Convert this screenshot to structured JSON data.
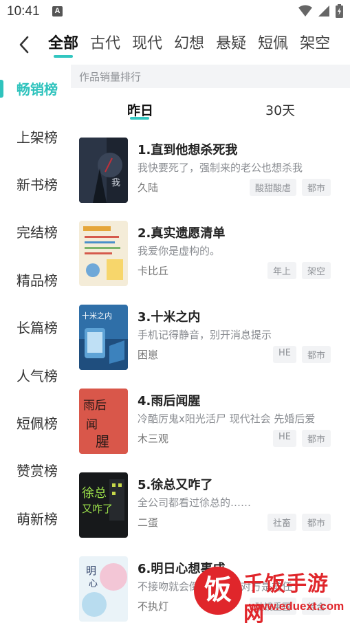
{
  "status": {
    "time": "10:41",
    "badge": "A"
  },
  "top_tabs": [
    "全部",
    "古代",
    "现代",
    "幻想",
    "悬疑",
    "短佩",
    "架空"
  ],
  "top_tabs_active": 0,
  "sidebar": [
    "畅销榜",
    "上架榜",
    "新书榜",
    "完结榜",
    "精品榜",
    "长篇榜",
    "人气榜",
    "短佩榜",
    "赞赏榜",
    "萌新榜"
  ],
  "sidebar_active": 0,
  "rank_header": "作品销量排行",
  "period_tabs": {
    "yesterday": "昨日",
    "thirty_days": "30天"
  },
  "accent_color": "#32c6c0",
  "books": [
    {
      "title": "1.直到他想杀死我",
      "desc": "我快要死了，强制来的老公也想杀我",
      "author": "久陆",
      "tags": [
        "酸甜酸虐",
        "都市"
      ]
    },
    {
      "title": "2.真实遗愿清单",
      "desc": "我爱你是虚构的。",
      "author": "卡比丘",
      "tags": [
        "年上",
        "架空"
      ]
    },
    {
      "title": "3.十米之内",
      "desc": "手机记得静音，别开消息提示",
      "author": "困崽",
      "tags": [
        "HE",
        "都市"
      ]
    },
    {
      "title": "4.雨后闻腥",
      "desc": "冷酷厉鬼x阳光活尸 现代社会 先婚后爱",
      "author": "木三观",
      "tags": [
        "HE",
        "都市"
      ]
    },
    {
      "title": "5.徐总又咋了",
      "desc": "全公司都看过徐总的……",
      "author": "二蛋",
      "tags": [
        "社畜",
        "都市"
      ]
    },
    {
      "title": "6.明日心想事成",
      "desc": "不接吻就会倒霉……之对方是前任",
      "author": "不执灯",
      "tags": [
        "破镜重圆",
        "综合"
      ]
    }
  ],
  "watermark": {
    "logo_char": "饭",
    "title": "千饭手游网",
    "url": "www.eduext.com"
  },
  "icons": {
    "back": "chevron-left-icon",
    "wifi": "wifi-icon",
    "signal": "signal-icon",
    "battery": "battery-icon"
  }
}
